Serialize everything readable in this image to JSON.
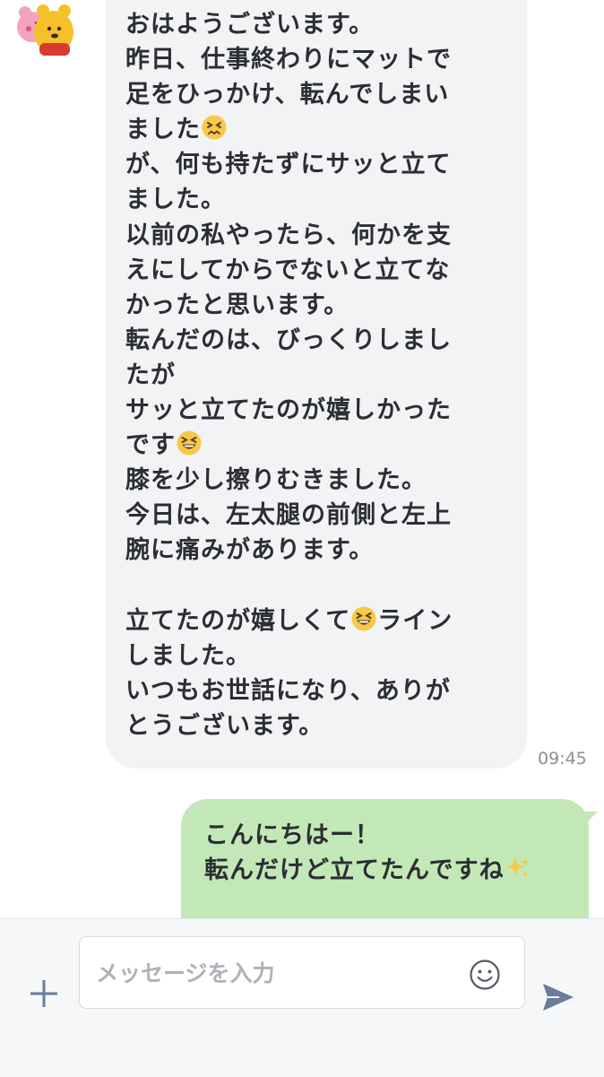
{
  "incoming": {
    "lines": [
      {
        "text": "おはようございます。"
      },
      {
        "text": "昨日、仕事終わりにマットで"
      },
      {
        "text": "足をひっかけ、転んでしまい"
      },
      {
        "text": "ました",
        "emoji": "persevering-face-icon"
      },
      {
        "text": "が、何も持たずにサッと立て"
      },
      {
        "text": "ました。"
      },
      {
        "text": "以前の私やったら、何かを支"
      },
      {
        "text": "えにしてからでないと立てな"
      },
      {
        "text": "かったと思います。"
      },
      {
        "text": "転んだのは、びっくりしまし"
      },
      {
        "text": "たが"
      },
      {
        "text": "サッと立てたのが嬉しかった"
      },
      {
        "text": "です",
        "emoji": "grinning-squinting-face-icon"
      },
      {
        "text": "膝を少し擦りむきました。"
      },
      {
        "text": "今日は、左太腿の前側と左上"
      },
      {
        "text": "腕に痛みがあります。"
      },
      {
        "text": ""
      },
      {
        "text": "立てたのが嬉しくて",
        "emoji": "grinning-squinting-face-icon",
        "after": "ライン"
      },
      {
        "text": "しました。"
      },
      {
        "text": "いつもお世話になり、ありが"
      },
      {
        "text": "とうございます。"
      }
    ],
    "time": "09:45",
    "avatar": "pooh-sticker-avatar"
  },
  "outgoing": {
    "line1": "こんにちはー！",
    "line2": "転んだけど立てたんですね",
    "line2_emoji": "sparkles-icon"
  },
  "composer": {
    "placeholder": "メッセージを入力",
    "value": ""
  },
  "colors": {
    "incoming_bubble": "#f2f3f5",
    "outgoing_bubble": "#c3e8b8",
    "text": "#2b2e33",
    "time": "#8a8f96",
    "send_icon": "#6b7b9a"
  }
}
